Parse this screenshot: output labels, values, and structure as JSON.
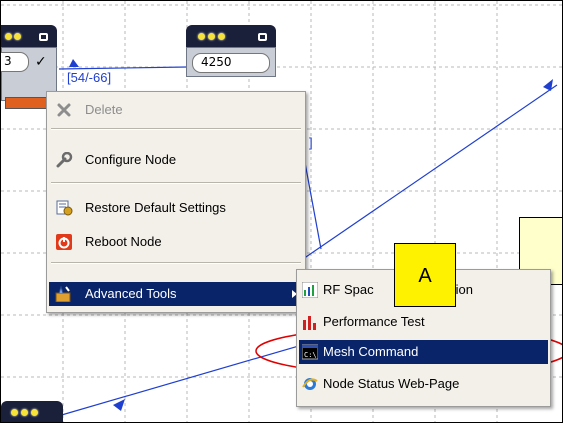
{
  "canvas": {
    "link_label_left": "[54/-66]",
    "link_label_mid": "]",
    "node_left_field": "3",
    "node_left_check": "✓",
    "node_right_field": "4250"
  },
  "context_menu": {
    "items": [
      {
        "label": "Delete",
        "icon": "delete-x-icon",
        "enabled": false
      },
      {
        "label": "Configure Node",
        "icon": "wrench-icon",
        "enabled": true
      },
      {
        "label": "Restore Default Settings",
        "icon": "restore-settings-icon",
        "enabled": true
      },
      {
        "label": "Reboot Node",
        "icon": "reboot-power-icon",
        "enabled": true
      },
      {
        "label": "Advanced Tools",
        "icon": "advanced-tools-icon",
        "enabled": true,
        "highlighted": true,
        "has_submenu": true
      }
    ]
  },
  "submenu": {
    "items": [
      {
        "label": "RF Spac",
        "label_tail": "tion",
        "icon": "rf-chart-icon"
      },
      {
        "label": "Performance Test",
        "icon": "performance-bars-icon"
      },
      {
        "label": "Mesh Command",
        "icon": "command-prompt-icon",
        "highlighted": true
      },
      {
        "label": "Node Status Web-Page",
        "icon": "ie-browser-icon"
      }
    ]
  },
  "annotation": {
    "callout_letter": "A",
    "highlight_color": "#e00000",
    "callout_color": "#fff200"
  },
  "colors": {
    "menu_highlight": "#0a246a",
    "link_line": "#1f3fd0",
    "grid": "#b8b8b8"
  }
}
